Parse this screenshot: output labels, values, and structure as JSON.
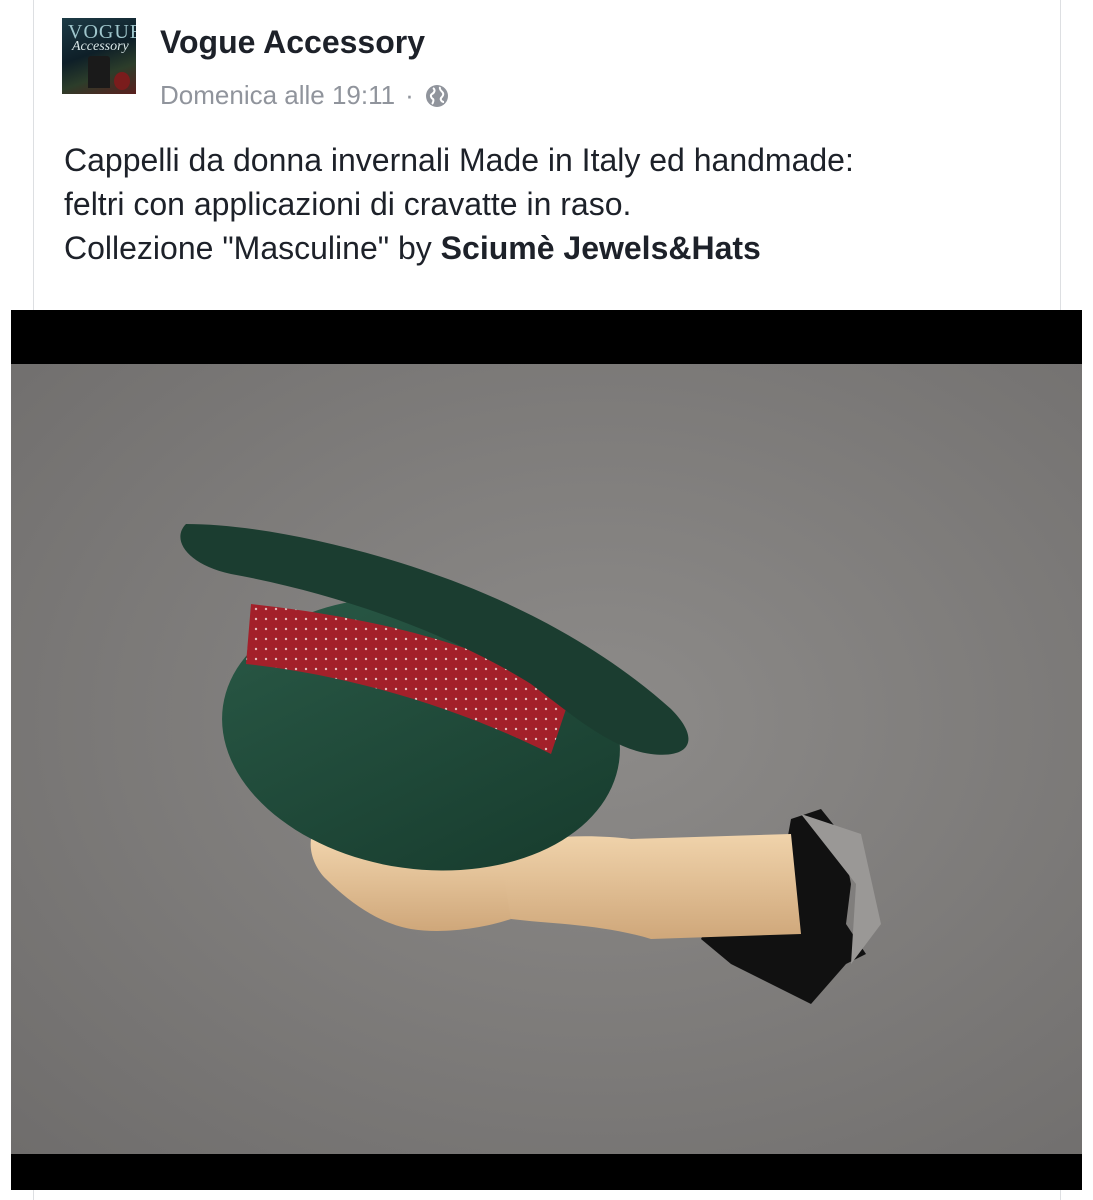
{
  "post": {
    "page_name": "Vogue Accessory",
    "avatar": {
      "logo_text": "VOGUE",
      "sub_text": "Accessory"
    },
    "meta": {
      "time": "Domenica alle 19:11",
      "separator": "·",
      "privacy_icon": "globe-icon"
    },
    "text": {
      "line1": "Cappelli da donna invernali Made in Italy ed handmade:",
      "line2": "feltri con applicazioni di cravatte in raso.",
      "line3_prefix": "Collezione \"Masculine\" by",
      "mention": "Sciumè Jewels&Hats"
    },
    "photo": {
      "subject": "green felt hat with red dotted tie band held by wooden mannequin hand through torn grey paper",
      "colors": {
        "background": "#8a8886",
        "hat": "#1f4a3a",
        "band": "#a3202a",
        "hand": "#e8c9a0"
      }
    }
  }
}
